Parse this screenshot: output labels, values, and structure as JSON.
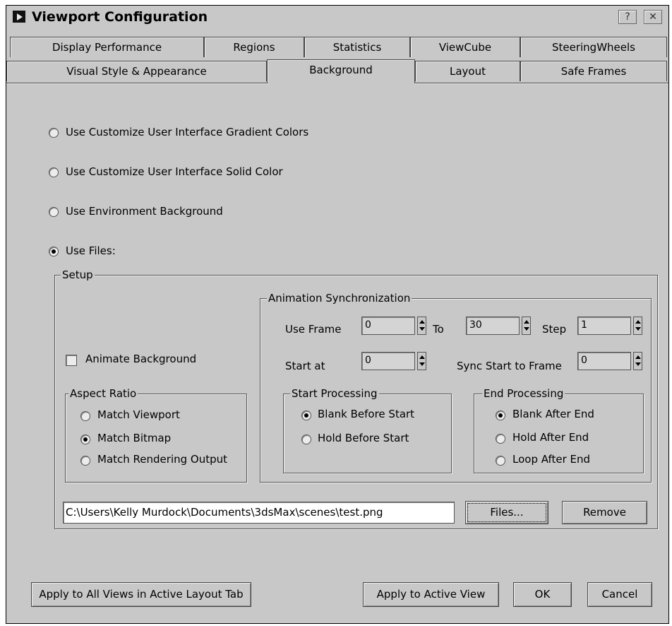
{
  "window": {
    "title": "Viewport Configuration",
    "help_label": "?",
    "close_label": "✕"
  },
  "tabs_row1": [
    "Display Performance",
    "Regions",
    "Statistics",
    "ViewCube",
    "SteeringWheels"
  ],
  "tabs_row2": [
    "Visual Style & Appearance",
    "Background",
    "Layout",
    "Safe Frames"
  ],
  "active_tab": "Background",
  "options": [
    {
      "label": "Use Customize User Interface Gradient Colors",
      "selected": false
    },
    {
      "label": "Use Customize User Interface Solid Color",
      "selected": false
    },
    {
      "label": "Use Environment Background",
      "selected": false
    },
    {
      "label": "Use Files:",
      "selected": true
    }
  ],
  "setup": {
    "label": "Setup",
    "animate_background": "Animate Background",
    "aspect_ratio": {
      "label": "Aspect Ratio",
      "options": [
        {
          "label": "Match Viewport",
          "selected": false
        },
        {
          "label": "Match Bitmap",
          "selected": true
        },
        {
          "label": "Match Rendering Output",
          "selected": false
        }
      ]
    },
    "anim_sync": {
      "label": "Animation Synchronization",
      "use_frame_label": "Use Frame",
      "use_frame_value": "0",
      "to_label": "To",
      "to_value": "30",
      "step_label": "Step",
      "step_value": "1",
      "start_at_label": "Start at",
      "start_at_value": "0",
      "sync_label": "Sync Start to Frame",
      "sync_value": "0"
    },
    "start_processing": {
      "label": "Start Processing",
      "options": [
        {
          "label": "Blank Before Start",
          "selected": true
        },
        {
          "label": "Hold Before Start",
          "selected": false
        }
      ]
    },
    "end_processing": {
      "label": "End Processing",
      "options": [
        {
          "label": "Blank After End",
          "selected": true
        },
        {
          "label": "Hold After End",
          "selected": false
        },
        {
          "label": "Loop After End",
          "selected": false
        }
      ]
    },
    "file_path": "C:\\Users\\Kelly Murdock\\Documents\\3dsMax\\scenes\\test.png",
    "files_button": "Files...",
    "remove_button": "Remove"
  },
  "buttons": {
    "apply_all": "Apply to All Views in Active Layout Tab",
    "apply_active": "Apply to Active View",
    "ok": "OK",
    "cancel": "Cancel"
  }
}
